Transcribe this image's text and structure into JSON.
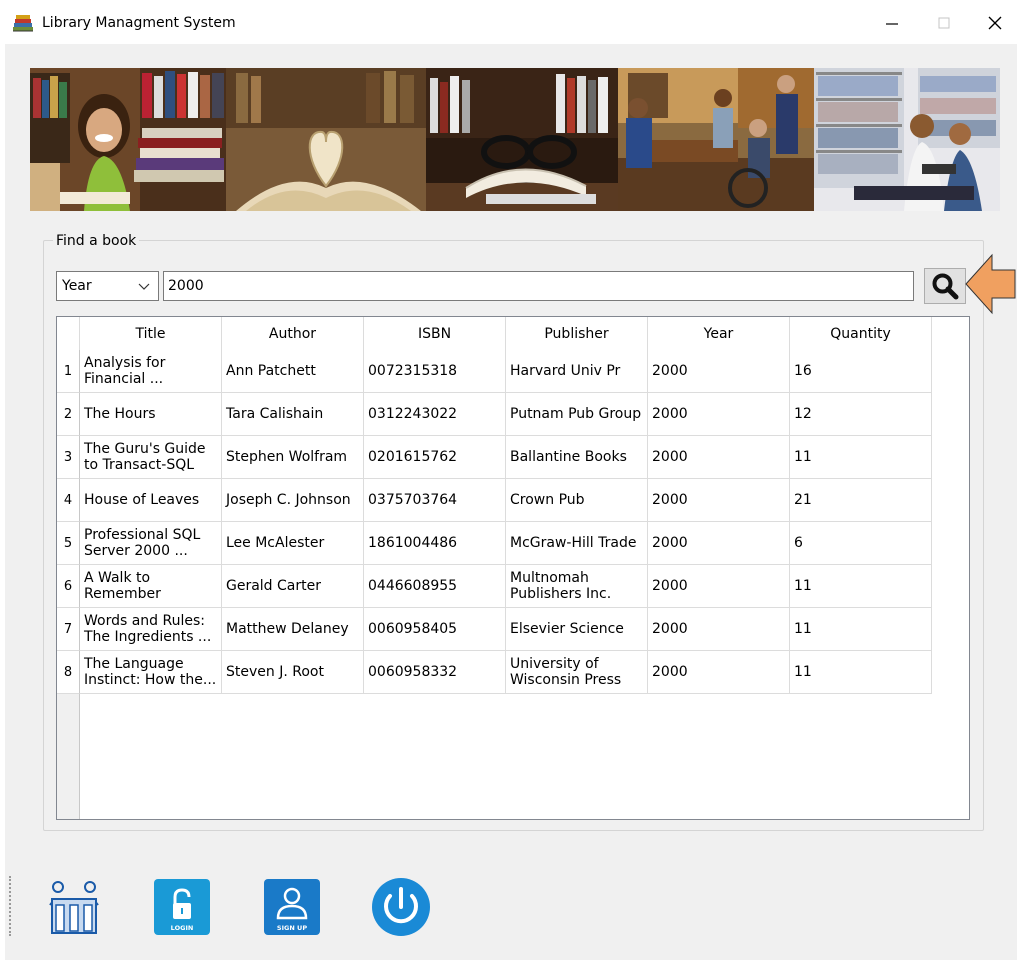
{
  "window": {
    "title": "Library Managment System",
    "minimize_icon": "minimize-icon",
    "maximize_icon": "maximize-icon",
    "close_icon": "close-icon"
  },
  "banner": {
    "panels": [
      "girl-reading",
      "open-book-heart",
      "books-and-glasses",
      "library-help-desk",
      "students-reading"
    ]
  },
  "search": {
    "group_title": "Find a book",
    "filter_selected": "Year",
    "query": "2000",
    "button_icon": "search-icon"
  },
  "table": {
    "columns": [
      "Title",
      "Author",
      "ISBN",
      "Publisher",
      "Year",
      "Quantity"
    ],
    "rows": [
      {
        "n": "1",
        "title": "Analysis for\nFinancial ...",
        "author": "Ann Patchett",
        "isbn": "0072315318",
        "publisher": "Harvard Univ Pr",
        "year": "2000",
        "quantity": "16"
      },
      {
        "n": "2",
        "title": "The Hours",
        "author": "Tara Calishain",
        "isbn": "0312243022",
        "publisher": "Putnam Pub Group",
        "year": "2000",
        "quantity": "12"
      },
      {
        "n": "3",
        "title": "The Guru's Guide\nto Transact-SQL",
        "author": "Stephen Wolfram",
        "isbn": "0201615762",
        "publisher": "Ballantine Books",
        "year": "2000",
        "quantity": "11"
      },
      {
        "n": "4",
        "title": "House of Leaves",
        "author": "Joseph C. Johnson",
        "isbn": "0375703764",
        "publisher": "Crown Pub",
        "year": "2000",
        "quantity": "21"
      },
      {
        "n": "5",
        "title": "Professional SQL\nServer 2000 ...",
        "author": "Lee McAlester",
        "isbn": "1861004486",
        "publisher": "McGraw-Hill Trade",
        "year": "2000",
        "quantity": "6"
      },
      {
        "n": "6",
        "title": "A Walk to\nRemember",
        "author": "Gerald Carter",
        "isbn": "0446608955",
        "publisher": "Multnomah\nPublishers Inc.",
        "year": "2000",
        "quantity": "11"
      },
      {
        "n": "7",
        "title": "Words and Rules:\nThe Ingredients ...",
        "author": "Matthew Delaney",
        "isbn": "0060958405",
        "publisher": "Elsevier Science",
        "year": "2000",
        "quantity": "11"
      },
      {
        "n": "8",
        "title": "The Language\nInstinct: How the...",
        "author": "Steven J. Root",
        "isbn": "0060958332",
        "publisher": "University of\nWisconsin Press",
        "year": "2000",
        "quantity": "11"
      }
    ]
  },
  "bottom_toolbar": {
    "buttons": [
      {
        "icon": "users-library-icon"
      },
      {
        "icon": "login-lock-icon",
        "label": "LOGIN"
      },
      {
        "icon": "signup-user-icon",
        "label": "SIGN UP"
      },
      {
        "icon": "power-icon"
      }
    ]
  },
  "colors": {
    "window_bg": "#f0f0f0",
    "accent_blue": "#1a9ad6",
    "arrow_orange": "#f0a060"
  }
}
